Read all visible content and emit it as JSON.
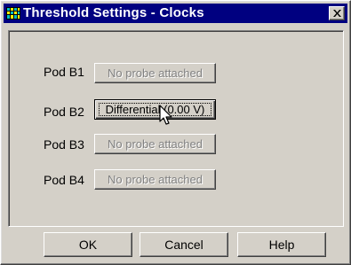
{
  "window": {
    "title": "Threshold Settings - Clocks",
    "icon": "app-grid-icon",
    "close_icon": "close-icon"
  },
  "pods": [
    {
      "label": "Pod B1",
      "button": "No probe attached",
      "enabled": false
    },
    {
      "label": "Pod B2",
      "button": "Differential (0.00 V)",
      "enabled": true
    },
    {
      "label": "Pod B3",
      "button": "No probe attached",
      "enabled": false
    },
    {
      "label": "Pod B4",
      "button": "No probe attached",
      "enabled": false
    }
  ],
  "buttons": {
    "ok": "OK",
    "cancel": "Cancel",
    "help": "Help"
  },
  "colors": {
    "titlebar": "#000080",
    "face": "#d4d0c8",
    "disabled_text": "#808080"
  }
}
